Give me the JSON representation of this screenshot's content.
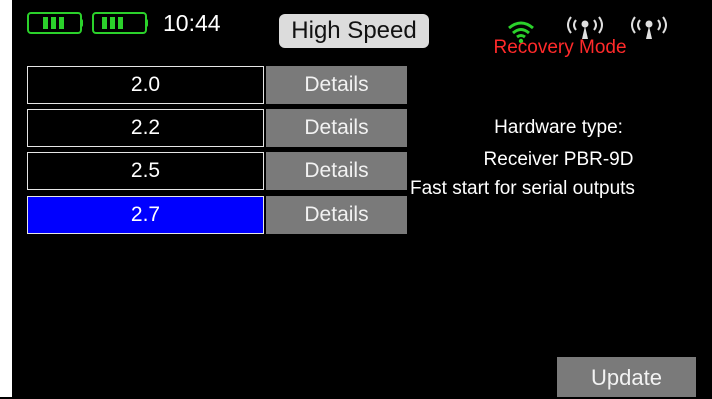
{
  "status_bar": {
    "clock": "10:44",
    "mode": "High Speed",
    "battery_color": "#2bd12b",
    "icons": [
      "battery-icon",
      "battery-icon",
      "wifi-icon",
      "antenna-icon",
      "antenna-icon"
    ]
  },
  "versions": [
    {
      "label": "2.0",
      "button": "Details",
      "selected": false
    },
    {
      "label": "2.2",
      "button": "Details",
      "selected": false
    },
    {
      "label": "2.5",
      "button": "Details",
      "selected": false
    },
    {
      "label": "2.7",
      "button": "Details",
      "selected": true
    }
  ],
  "info": {
    "mode_title": "Recovery Mode",
    "hardware_label": "Hardware type:",
    "hardware_value": "Receiver PBR-9D",
    "note": "Fast start for serial outputs"
  },
  "update_button": "Update",
  "colors": {
    "selected_row": "#0000ff",
    "button": "#7a7a7a",
    "recovery": "#ff2a2a"
  }
}
